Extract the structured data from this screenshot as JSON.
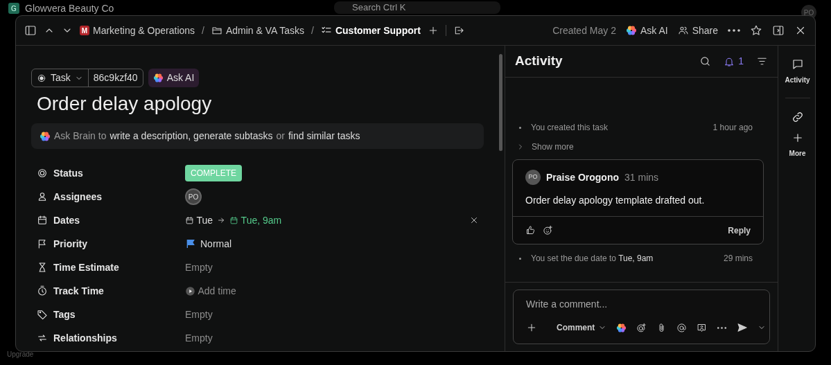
{
  "app": {
    "workspace": "Glowvera Beauty Co",
    "workspace_initial": "G",
    "search": {
      "placeholder": "Search Ctrl K"
    },
    "user_initials": "PO",
    "upgrade": "Upgrade"
  },
  "breadcrumb": [
    {
      "kind": "space",
      "badge": "M",
      "label": "Marketing & Operations"
    },
    {
      "kind": "folder",
      "separator": "/",
      "label": "Admin & VA Tasks"
    },
    {
      "kind": "list",
      "separator": "/",
      "label": "Customer Support"
    }
  ],
  "header": {
    "created": "Created May 2",
    "ask_ai": "Ask AI",
    "share": "Share"
  },
  "task": {
    "type": "Task",
    "id": "86c9kzf40",
    "ask_ai": "Ask AI",
    "title": "Order delay apology",
    "brain": [
      {
        "text": "Ask Brain to",
        "muted": true
      },
      {
        "text": "write a description, generate subtasks",
        "muted": false
      },
      {
        "text": "or",
        "muted": true
      },
      {
        "text": "find similar tasks",
        "muted": false
      }
    ],
    "fields": [
      {
        "kind": "status",
        "label": "Status",
        "value": "COMPLETE"
      },
      {
        "kind": "assignee",
        "label": "Assignees",
        "value": "PO"
      },
      {
        "kind": "dates",
        "label": "Dates",
        "start": "Tue",
        "due": "Tue, 9am"
      },
      {
        "kind": "priority",
        "label": "Priority",
        "value": "Normal"
      },
      {
        "kind": "estimate",
        "label": "Time Estimate",
        "value": "Empty"
      },
      {
        "kind": "track",
        "label": "Track Time",
        "value": "Add time"
      },
      {
        "kind": "tags",
        "label": "Tags",
        "value": "Empty"
      },
      {
        "kind": "relationships",
        "label": "Relationships",
        "value": "Empty"
      }
    ]
  },
  "activity": {
    "title": "Activity",
    "notifications": "1",
    "items": [
      {
        "kind": "event",
        "text": "You created this task",
        "time": "1 hour ago"
      },
      {
        "kind": "more",
        "text": "Show more"
      },
      {
        "kind": "comment",
        "initials": "PO",
        "author": "Praise Orogono",
        "time": "31 mins",
        "text": "Order delay apology template drafted out.",
        "reply": "Reply"
      },
      {
        "kind": "event",
        "text": "You set the due date to **Tue, 9am**",
        "time": "29 mins"
      }
    ],
    "composer": {
      "placeholder": "Write a comment...",
      "mode": "Comment"
    }
  },
  "rail": [
    {
      "kind": "activity",
      "label": "Activity"
    },
    {
      "kind": "link"
    },
    {
      "kind": "more",
      "label": "More"
    }
  ]
}
